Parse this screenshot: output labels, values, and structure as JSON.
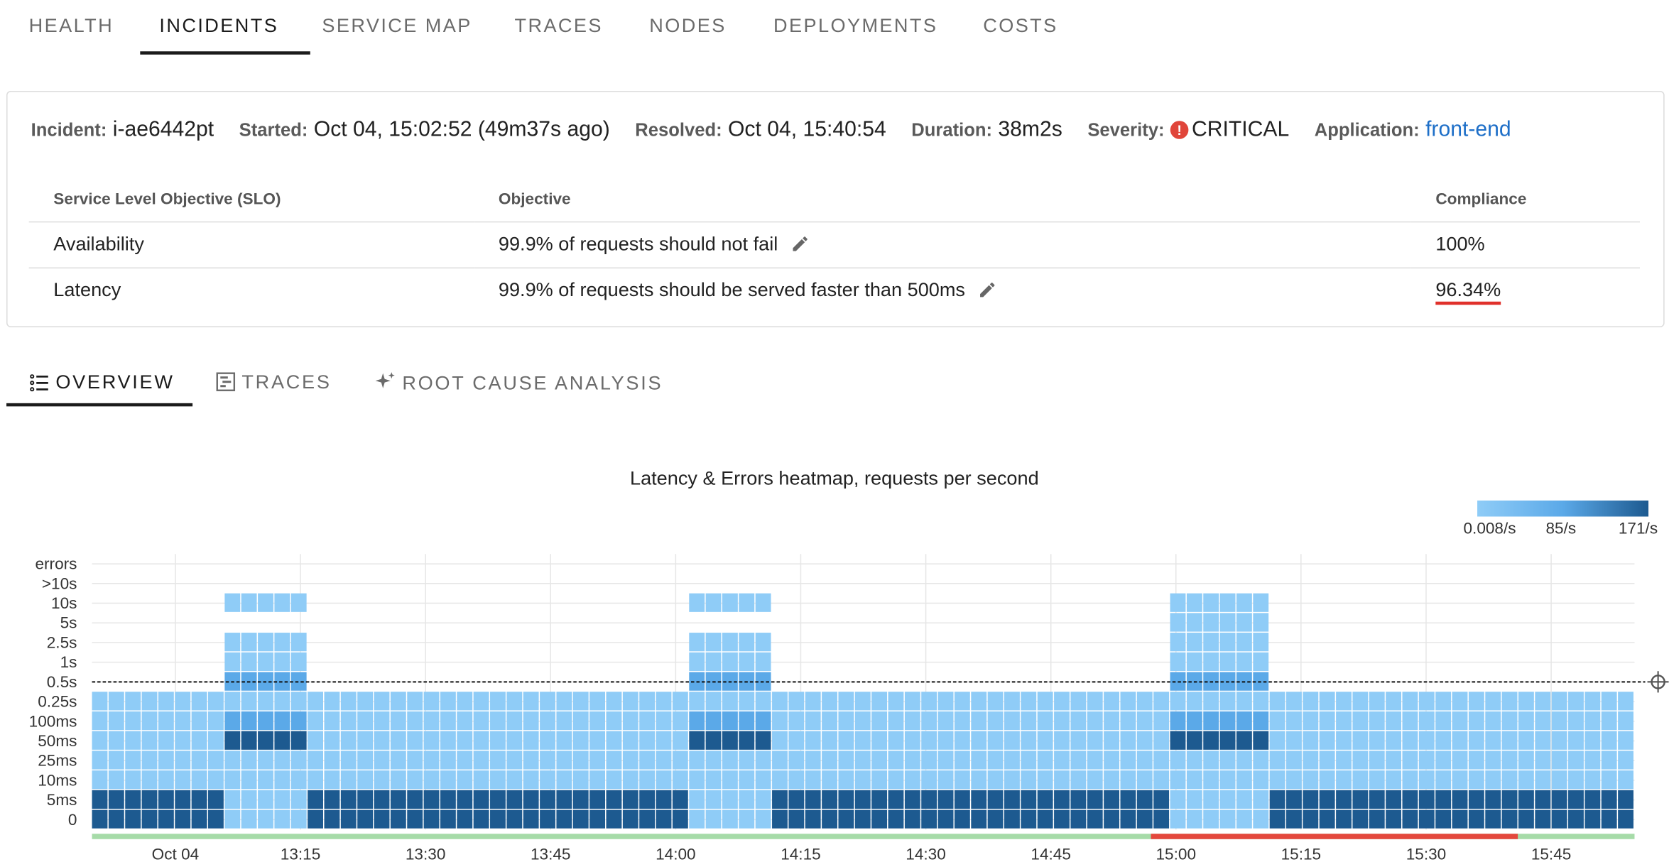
{
  "nav": {
    "tabs": [
      {
        "label": "HEALTH",
        "active": false
      },
      {
        "label": "INCIDENTS",
        "active": true
      },
      {
        "label": "SERVICE MAP",
        "active": false
      },
      {
        "label": "TRACES",
        "active": false
      },
      {
        "label": "NODES",
        "active": false
      },
      {
        "label": "DEPLOYMENTS",
        "active": false
      },
      {
        "label": "COSTS",
        "active": false
      }
    ]
  },
  "incident": {
    "id_label": "Incident:",
    "id": "i-ae6442pt",
    "started_label": "Started:",
    "started": "Oct 04, 15:02:52 (49m37s ago)",
    "resolved_label": "Resolved:",
    "resolved": "Oct 04, 15:40:54",
    "duration_label": "Duration:",
    "duration": "38m2s",
    "severity_label": "Severity:",
    "severity": "CRITICAL",
    "severity_icon": "alert-circle-icon",
    "severity_color": "#e0453a",
    "application_label": "Application:",
    "application": "front-end"
  },
  "slo_table": {
    "headers": [
      "Service Level Objective (SLO)",
      "Objective",
      "Compliance"
    ],
    "rows": [
      {
        "name": "Availability",
        "objective": "99.9% of requests should not fail",
        "compliance": "100%",
        "violated": false
      },
      {
        "name": "Latency",
        "objective": "99.9% of requests should be served faster than 500ms",
        "compliance": "96.34%",
        "violated": true
      }
    ]
  },
  "subtabs": [
    {
      "label": "OVERVIEW",
      "icon": "list-icon",
      "active": true
    },
    {
      "label": "TRACES",
      "icon": "trace-icon",
      "active": false
    },
    {
      "label": "ROOT CAUSE ANALYSIS",
      "icon": "sparkle-icon",
      "active": false
    }
  ],
  "chart_data": {
    "type": "heatmap",
    "title": "Latency & Errors heatmap, requests per second",
    "legend": {
      "min": "0.008/s",
      "mid": "85/s",
      "max": "171/s",
      "placement": "top-right",
      "colors": [
        "#8fccf7",
        "#5ba9e8",
        "#1d5a90"
      ]
    },
    "y_buckets": [
      "0",
      "5ms",
      "10ms",
      "25ms",
      "50ms",
      "100ms",
      "0.25s",
      "0.5s",
      "1s",
      "2.5s",
      "5s",
      "10s",
      ">10s",
      "errors"
    ],
    "x_ticks": [
      "Oct 04",
      "13:15",
      "13:30",
      "13:45",
      "14:00",
      "14:15",
      "14:30",
      "14:45",
      "15:00",
      "15:15",
      "15:30",
      "15:45"
    ],
    "x_range": [
      "12:50",
      "15:55"
    ],
    "slo_threshold": "0.5s",
    "incident_window": {
      "start": "14:57",
      "end": "15:41"
    },
    "spikes": [
      {
        "start": "13:05",
        "end": "13:16",
        "buckets": {
          "5ms": "light",
          "50ms": "dark",
          "100ms": "mid",
          "0.5s": "mid",
          "1s": "light",
          "10s": "light"
        }
      },
      {
        "start": "14:01",
        "end": "14:12",
        "buckets": {
          "5ms": "light",
          "50ms": "dark",
          "100ms": "mid",
          "0.5s": "mid",
          "1s": "light",
          "10s": "light"
        }
      },
      {
        "start": "15:00",
        "end": "15:11",
        "buckets": {
          "5ms": "light",
          "50ms": "dark",
          "100ms": "mid",
          "0.5s": "mid",
          "1s": "light",
          "5s": "light",
          "10s": "light"
        }
      }
    ],
    "baseline": {
      "0": "dark",
      "5ms": "dark",
      "10ms": "light",
      "25ms": "light",
      "50ms": "light",
      "100ms": "light",
      "0.25s": "light"
    },
    "grid": true
  }
}
